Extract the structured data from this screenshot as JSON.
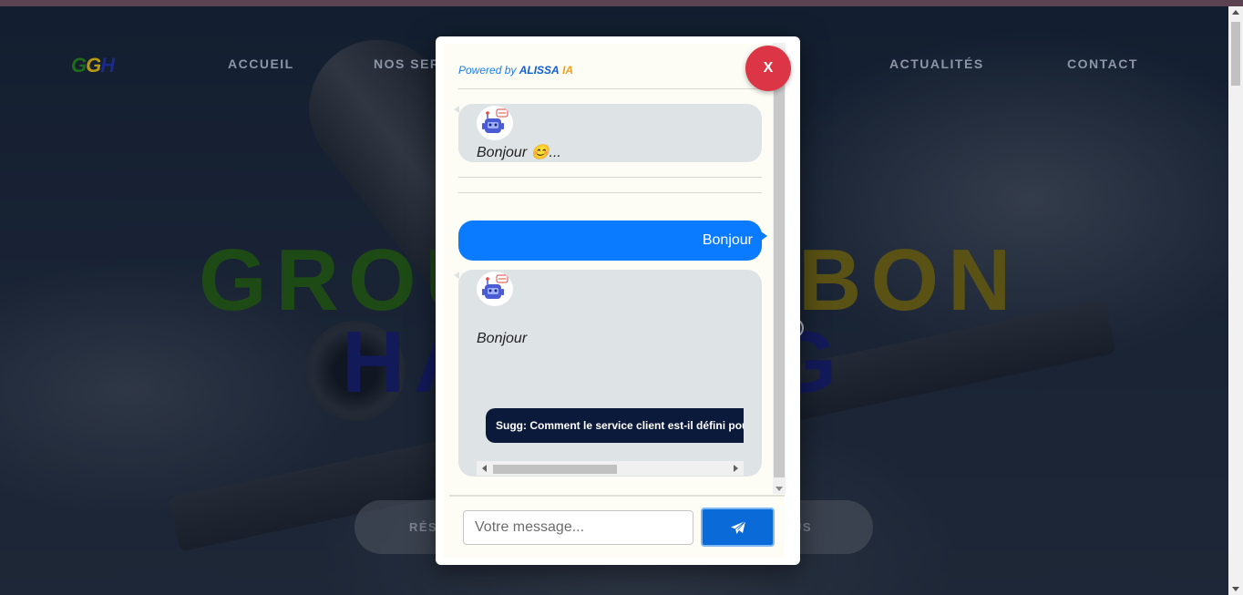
{
  "site": {
    "logo_text": "GGH",
    "nav": [
      "ACCUEIL",
      "NOS SERVICES",
      "ACTUALITÉS",
      "CONTACT"
    ],
    "hero_title_line1_left": "GROU",
    "hero_title_line1_right": "BON",
    "hero_title_line2_left": "HA",
    "hero_title_line2_right": "G",
    "cta_left": "RÉS",
    "cta_right": "US"
  },
  "chat": {
    "powered_prefix": "Powered by",
    "powered_brand": "ALISSA",
    "powered_ia": "IA",
    "close_label": "X",
    "messages": [
      {
        "from": "bot",
        "text": "Bonjour 😊..."
      },
      {
        "from": "user",
        "text": "Bonjour"
      },
      {
        "from": "bot",
        "text": "Bonjour"
      }
    ],
    "suggestion": "Sugg: Comment le service client est-il défini pou",
    "input_placeholder": "Votre message...",
    "send_icon": "paper-plane-icon"
  },
  "colors": {
    "close": "#dc3545",
    "user_bubble": "#0a7bff",
    "bot_bubble": "#dee3e6",
    "send": "#0a6ad8",
    "suggestion_bg": "#0b1a3a"
  }
}
